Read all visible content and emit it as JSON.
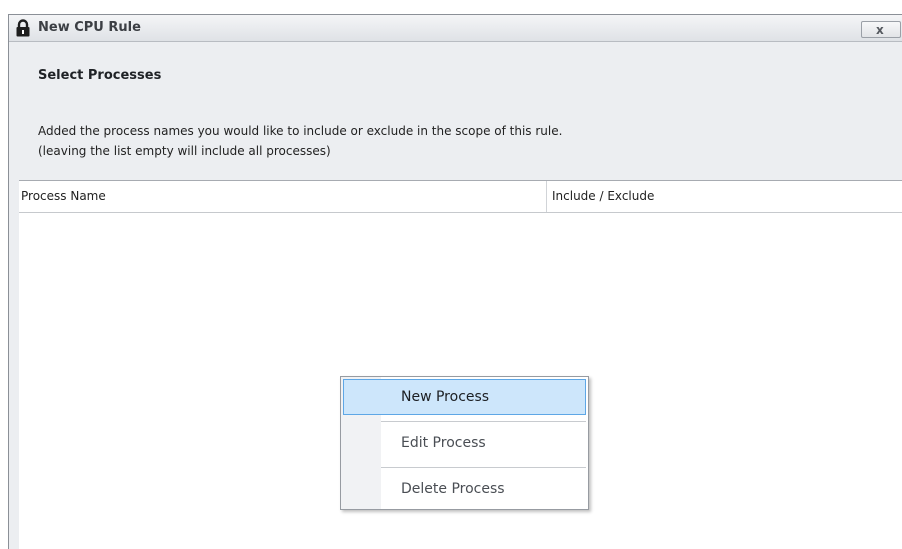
{
  "window": {
    "title": "New CPU Rule",
    "close_label": "x",
    "lock_icon": "lock-icon"
  },
  "header": {
    "heading": "Select Processes",
    "description_line1": "Added the process names you would like to include or exclude in the scope of this rule.",
    "description_line2": "(leaving the list empty will include all processes)"
  },
  "list": {
    "columns": [
      "Process Name",
      "Include / Exclude"
    ],
    "rows": []
  },
  "context_menu": {
    "items": [
      {
        "label": "New Process",
        "state": "hover"
      },
      {
        "label": "Edit Process",
        "state": "disabled"
      },
      {
        "label": "Delete Process",
        "state": "disabled"
      }
    ]
  },
  "colors": {
    "menu_hover_fill": "#cde6fb",
    "menu_hover_border": "#5ea7e6",
    "window_bg": "#eceef1"
  }
}
